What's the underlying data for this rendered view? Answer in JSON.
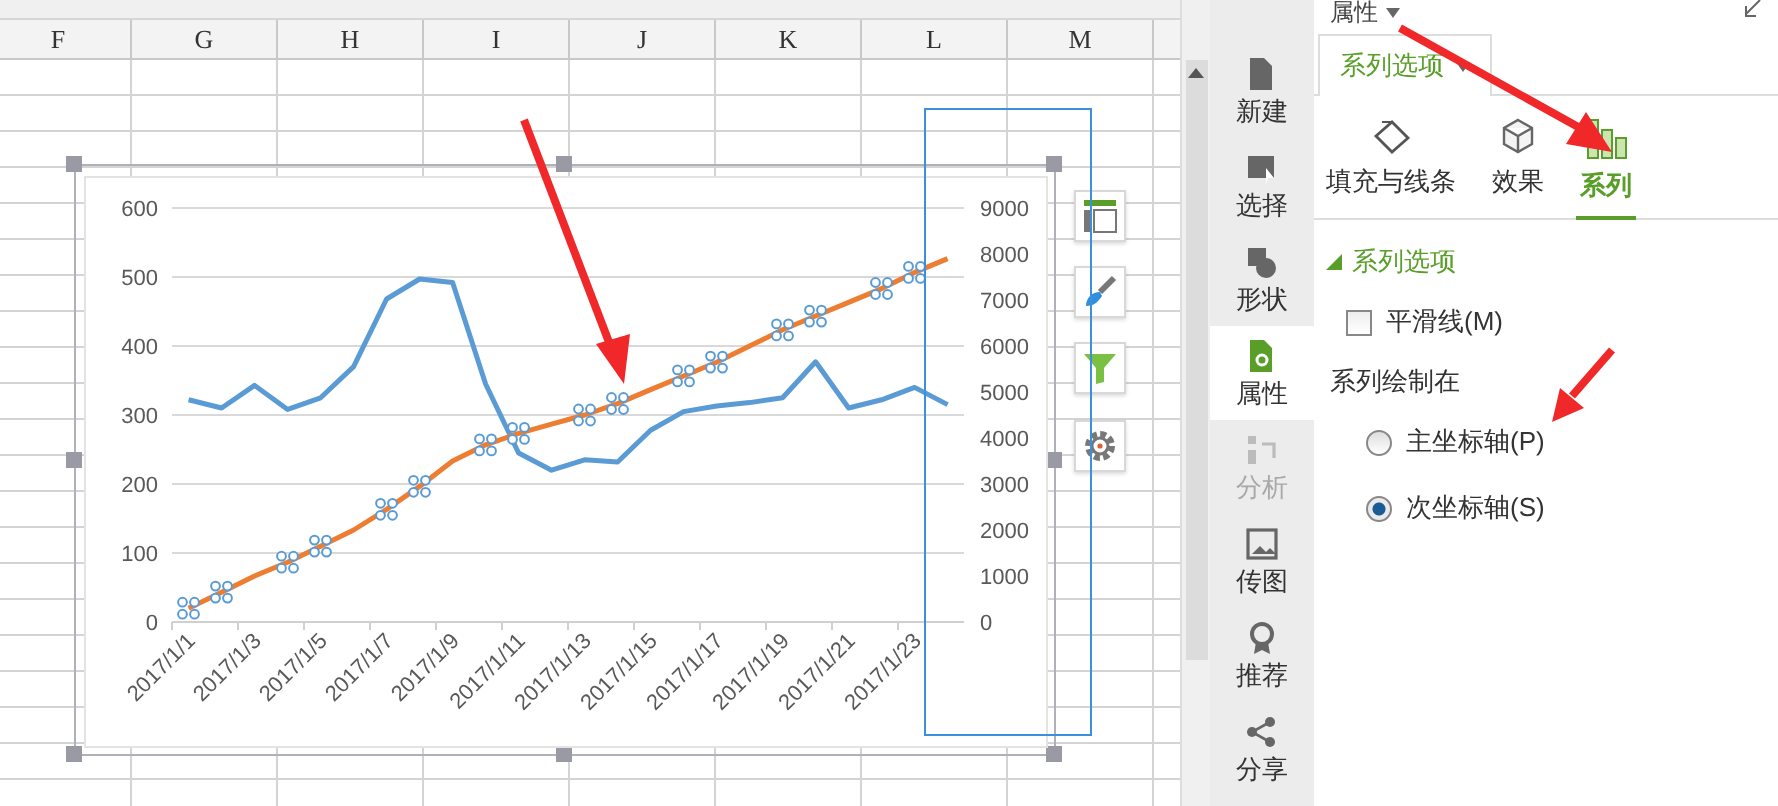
{
  "sheet": {
    "columns": [
      "F",
      "G",
      "H",
      "I",
      "J",
      "K",
      "L",
      "M"
    ]
  },
  "chart": {
    "chart_data": {
      "type": "line",
      "categories": [
        "2017/1/1",
        null,
        "2017/1/3",
        null,
        "2017/1/5",
        null,
        "2017/1/7",
        null,
        "2017/1/9",
        null,
        "2017/1/11",
        null,
        "2017/1/13",
        null,
        "2017/1/15",
        null,
        "2017/1/17",
        null,
        "2017/1/19",
        null,
        "2017/1/21",
        null,
        "2017/1/23",
        null
      ],
      "grid": true,
      "ylim": [
        0,
        600
      ],
      "yticks": [
        0,
        100,
        200,
        300,
        400,
        500,
        600
      ],
      "y2lim": [
        0,
        9000
      ],
      "y2ticks": [
        0,
        1000,
        2000,
        3000,
        4000,
        5000,
        6000,
        7000,
        8000,
        9000
      ],
      "series": [
        {
          "color": "#5b9bd5",
          "axis": "y",
          "values": [
            322,
            310,
            343,
            308,
            325,
            370,
            468,
            497,
            492,
            345,
            245,
            220,
            235,
            232,
            278,
            305,
            313,
            318,
            325,
            377,
            310,
            322,
            340,
            315
          ]
        },
        {
          "color": "#ed7d31",
          "axis": "y2",
          "values": [
            300,
            650,
            1000,
            1300,
            1650,
            2000,
            2450,
            2950,
            3500,
            3850,
            4100,
            4300,
            4500,
            4750,
            5050,
            5350,
            5650,
            6000,
            6350,
            6650,
            6950,
            7250,
            7600,
            7900
          ]
        }
      ]
    }
  },
  "side_strip": [
    {
      "label": "新建",
      "selected": false,
      "disabled": false
    },
    {
      "label": "选择",
      "selected": false,
      "disabled": false
    },
    {
      "label": "形状",
      "selected": false,
      "disabled": false
    },
    {
      "label": "属性",
      "selected": true,
      "disabled": false
    },
    {
      "label": "分析",
      "selected": false,
      "disabled": true
    },
    {
      "label": "传图",
      "selected": false,
      "disabled": false
    },
    {
      "label": "推荐",
      "selected": false,
      "disabled": false
    },
    {
      "label": "分享",
      "selected": false,
      "disabled": false
    }
  ],
  "panel": {
    "title": "属性",
    "tab": "系列选项",
    "sub_tabs": [
      {
        "label": "填充与线条",
        "selected": false
      },
      {
        "label": "效果",
        "selected": false
      },
      {
        "label": "系列",
        "selected": true
      }
    ],
    "section": {
      "title": "系列选项",
      "expanded": true
    },
    "smooth_line": {
      "label": "平滑线(M)",
      "checked": false
    },
    "plot_on_label": "系列绘制在",
    "axis_options": [
      {
        "label": "主坐标轴(P)",
        "selected": false
      },
      {
        "label": "次坐标轴(S)",
        "selected": true
      }
    ]
  }
}
